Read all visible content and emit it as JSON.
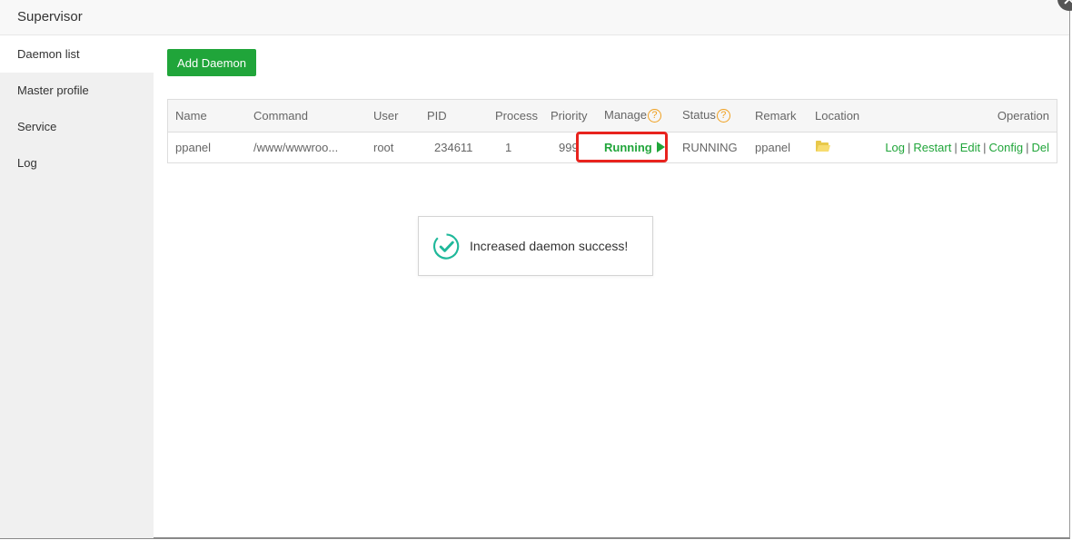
{
  "window": {
    "title": "Supervisor",
    "close_icon": "close-icon"
  },
  "sidebar": {
    "items": [
      {
        "label": "Daemon list",
        "active": true
      },
      {
        "label": "Master profile",
        "active": false
      },
      {
        "label": "Service",
        "active": false
      },
      {
        "label": "Log",
        "active": false
      }
    ]
  },
  "toolbar": {
    "add_daemon_label": "Add Daemon"
  },
  "table": {
    "headers": {
      "name": "Name",
      "command": "Command",
      "user": "User",
      "pid": "PID",
      "process": "Process",
      "priority": "Priority",
      "manage": "Manage",
      "status": "Status",
      "remark": "Remark",
      "location": "Location",
      "operation": "Operation"
    },
    "help_glyph": "?",
    "rows": [
      {
        "name": "ppanel",
        "command": "/www/wwwroo...",
        "user": "root",
        "pid": "234611",
        "process": "1",
        "priority": "999",
        "manage": "Running",
        "status": "RUNNING",
        "remark": "ppanel",
        "location_icon": "folder-icon",
        "operations": [
          "Log",
          "Restart",
          "Edit",
          "Config",
          "Del"
        ]
      }
    ]
  },
  "toast": {
    "message": "Increased daemon success!",
    "icon": "check-circle-icon"
  },
  "colors": {
    "accent": "#20a53a",
    "help": "#f0a020",
    "highlight": "#e8231e",
    "toast_check": "#1fb89a"
  }
}
